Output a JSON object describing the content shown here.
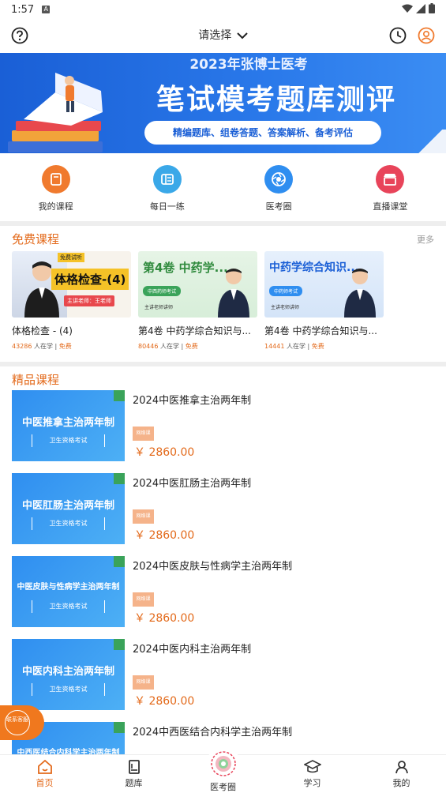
{
  "status_bar": {
    "time": "1:57",
    "badge": "A"
  },
  "header": {
    "selector_label": "请选择"
  },
  "banner": {
    "top_line": "2023年张博士医考",
    "main_title": "笔试模考题库测评",
    "pill_text": "精编题库、组卷答题、答案解析、备考评估"
  },
  "quick_nav": [
    {
      "label": "我的课程",
      "icon": "book-icon",
      "color": "#f07a2e"
    },
    {
      "label": "每日一练",
      "icon": "practice-icon",
      "color": "#3aa8e8"
    },
    {
      "label": "医考圈",
      "icon": "aperture-icon",
      "color": "#2f8ef0"
    },
    {
      "label": "直播课堂",
      "icon": "store-icon",
      "color": "#e8445a"
    }
  ],
  "free_section": {
    "title": "免费课程",
    "more": "更多",
    "cards": [
      {
        "title": "体格检查 - (4)",
        "count": "43286",
        "suffix": " 人在学 | ",
        "tag": "免费",
        "thumb_text": "体格检查-(4)",
        "thumb_badge": "免费试听",
        "thumb_teacher": "主讲老师：王老师"
      },
      {
        "title": "第4卷 中药学综合知识与...",
        "count": "80446",
        "suffix": " 人在学 | ",
        "tag": "免费",
        "thumb_text": "第4卷 中药学...",
        "thumb_badge": "中西药师考试",
        "thumb_teacher": "主讲老师讲师"
      },
      {
        "title": "第4卷 中药学综合知识与...",
        "count": "14441",
        "suffix": " 人在学 | ",
        "tag": "免费",
        "thumb_text": "中药学综合知识...",
        "thumb_badge": "中药师考试",
        "thumb_teacher": "主讲老师讲师"
      }
    ]
  },
  "premium_section": {
    "title": "精品课程",
    "items": [
      {
        "name": "2024中医推拿主治两年制",
        "thumb": "中医推拿主治两年制",
        "sub": "卫生资格考试",
        "tag": "网络课",
        "price": "￥ 2860.00"
      },
      {
        "name": "2024中医肛肠主治两年制",
        "thumb": "中医肛肠主治两年制",
        "sub": "卫生资格考试",
        "tag": "网络课",
        "price": "￥ 2860.00"
      },
      {
        "name": "2024中医皮肤与性病学主治两年制",
        "thumb": "中医皮肤与性病学主治两年制",
        "sub": "卫生资格考试",
        "tag": "网络课",
        "price": "￥ 2860.00"
      },
      {
        "name": "2024中医内科主治两年制",
        "thumb": "中医内科主治两年制",
        "sub": "卫生资格考试",
        "tag": "网络课",
        "price": "￥ 2860.00"
      },
      {
        "name": "2024中西医结合内科学主治两年制",
        "thumb": "中西医结合内科学主治两年制",
        "sub": "",
        "tag": "",
        "price": ""
      }
    ]
  },
  "float_contact": {
    "label": "联系客服"
  },
  "bottom_nav": [
    {
      "label": "首页",
      "icon": "home-icon",
      "active": true
    },
    {
      "label": "题库",
      "icon": "question-bank-icon",
      "active": false
    },
    {
      "label": "医考圈",
      "icon": "circle-icon",
      "active": false
    },
    {
      "label": "学习",
      "icon": "graduation-cap-icon",
      "active": false
    },
    {
      "label": "我的",
      "icon": "profile-icon",
      "active": false
    }
  ],
  "colors": {
    "accent": "#e36a1b",
    "banner": "#1a5fd6"
  }
}
